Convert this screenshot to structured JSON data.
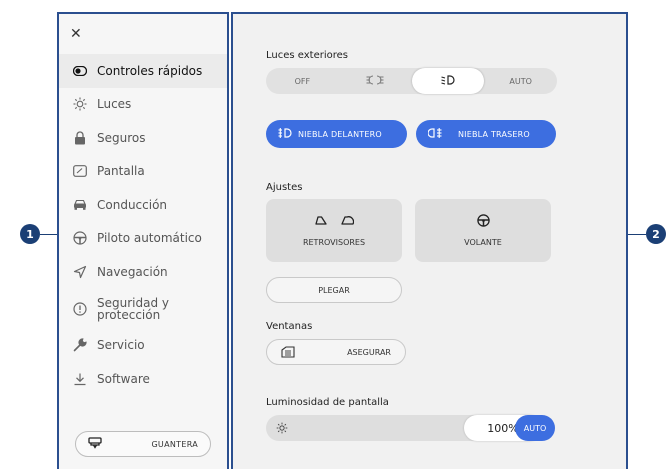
{
  "callouts": {
    "left": "1",
    "right": "2"
  },
  "sidebar": {
    "close": "✕",
    "items": [
      {
        "label": "Controles rápidos",
        "icon": "eye-toggle-icon",
        "active": true
      },
      {
        "label": "Luces",
        "icon": "sun-icon"
      },
      {
        "label": "Seguros",
        "icon": "lock-icon"
      },
      {
        "label": "Pantalla",
        "icon": "screen-icon"
      },
      {
        "label": "Conducción",
        "icon": "car-icon"
      },
      {
        "label": "Piloto automático",
        "icon": "steering-wheel-icon"
      },
      {
        "label": "Navegación",
        "icon": "navigation-arrow-icon"
      },
      {
        "label": "Seguridad y protección",
        "line1": "Seguridad y",
        "line2": "protección",
        "icon": "alert-circle-icon"
      },
      {
        "label": "Servicio",
        "icon": "wrench-icon"
      },
      {
        "label": "Software",
        "icon": "download-icon"
      }
    ],
    "glovebox": "GUANTERA"
  },
  "main": {
    "exterior_lights": {
      "title": "Luces exteriores",
      "options": [
        "OFF",
        "",
        "",
        "AUTO"
      ],
      "selected_index": 2
    },
    "fog_front": "NIEBLA DELANTERO",
    "fog_rear": "NIEBLA TRASERO",
    "settings": {
      "title": "Ajustes",
      "mirrors": "RETROVISORES",
      "steering": "VOLANTE",
      "fold": "PLEGAR"
    },
    "windows": {
      "title": "Ventanas",
      "lock": "ASEGURAR"
    },
    "brightness": {
      "title": "Luminosidad de pantalla",
      "value": "100%",
      "level_percent": 100,
      "auto": "AUTO"
    }
  },
  "colors": {
    "accent": "#3d6ee0",
    "border": "#2b4f8f",
    "callout": "#1b3f75"
  }
}
